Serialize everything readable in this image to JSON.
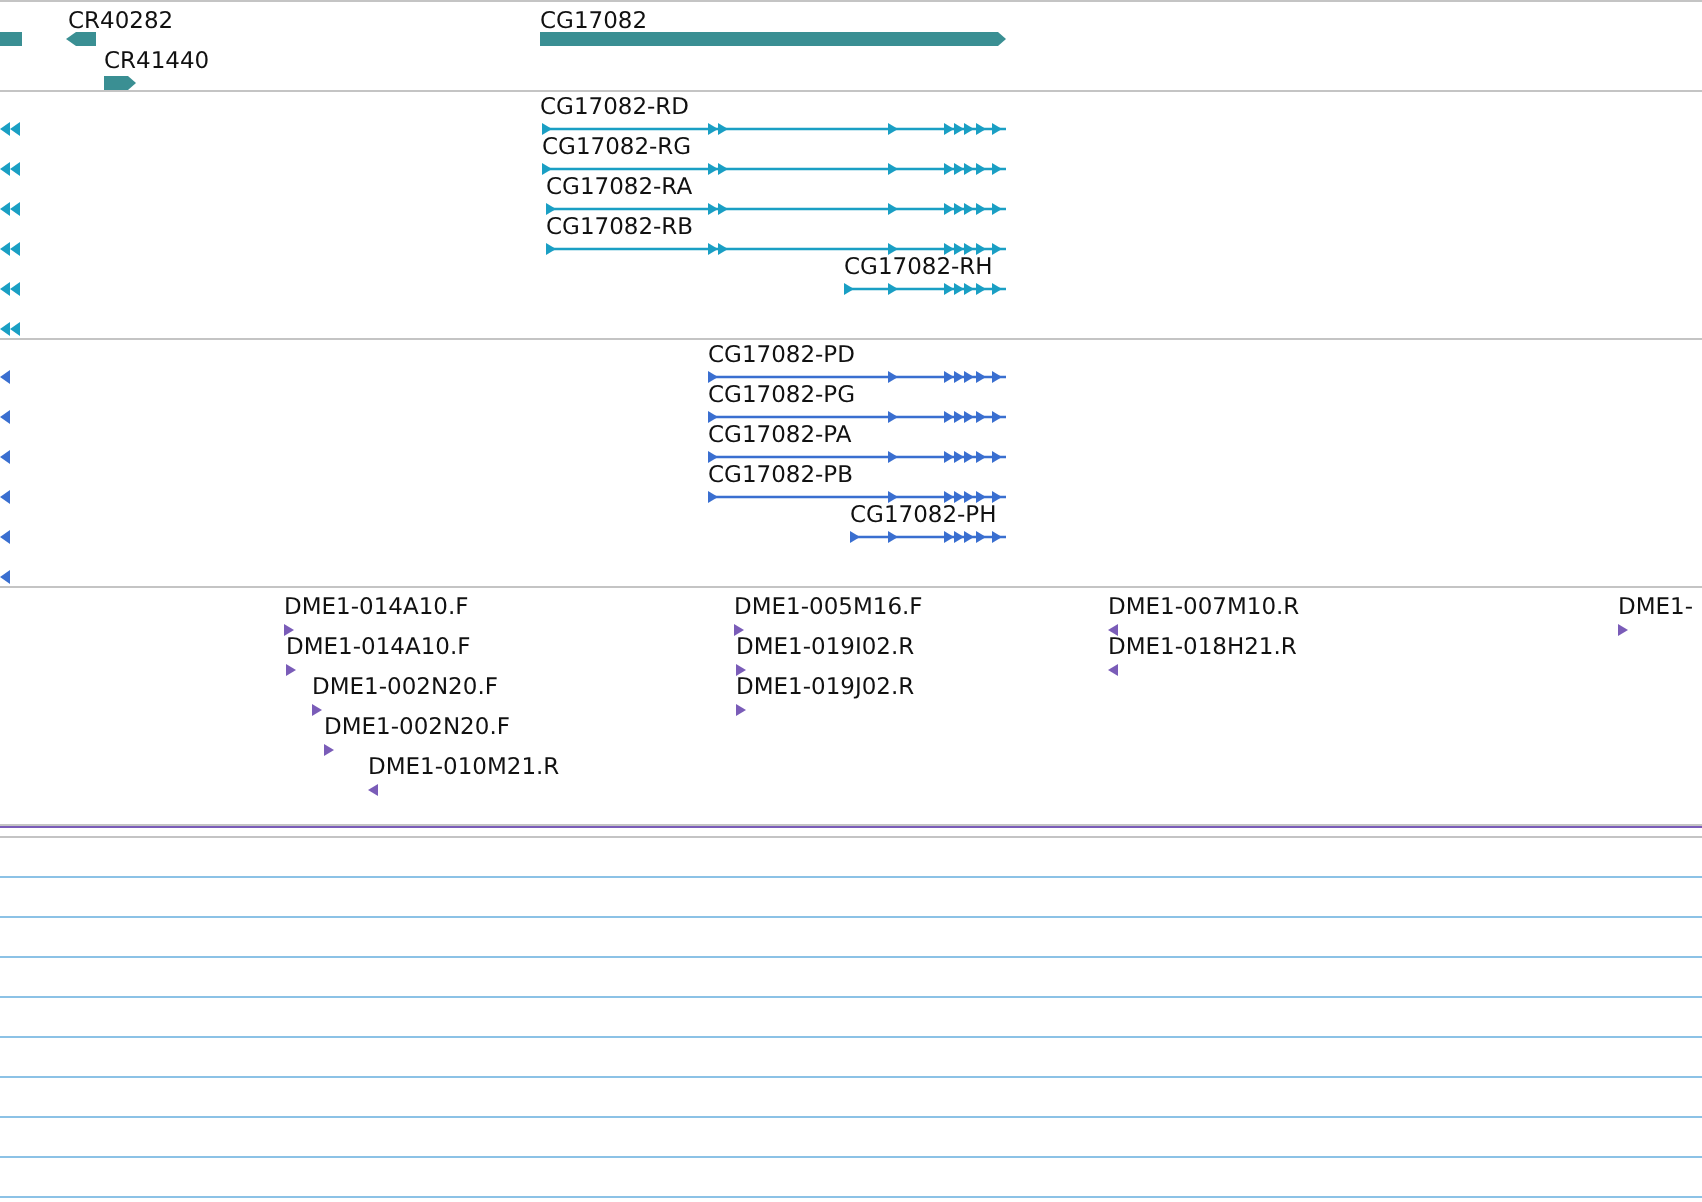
{
  "tracks": [
    {
      "kind": "genes",
      "features": [
        {
          "label": "CR40282",
          "reverse": true
        },
        {
          "label": "CG17082",
          "reverse": false
        },
        {
          "label": "CR41440",
          "reverse": false
        }
      ]
    },
    {
      "kind": "transcripts",
      "features": [
        {
          "label": "CG17082-RD"
        },
        {
          "label": "CG17082-RG"
        },
        {
          "label": "CG17082-RA"
        },
        {
          "label": "CG17082-RB"
        },
        {
          "label": "CG17082-RH"
        }
      ]
    },
    {
      "kind": "proteins",
      "features": [
        {
          "label": "CG17082-PD"
        },
        {
          "label": "CG17082-PG"
        },
        {
          "label": "CG17082-PA"
        },
        {
          "label": "CG17082-PB"
        },
        {
          "label": "CG17082-PH"
        }
      ]
    },
    {
      "kind": "clones",
      "features": [
        {
          "label": "DME1-014A10.F",
          "reverse": false
        },
        {
          "label": "DME1-014A10.F",
          "reverse": false
        },
        {
          "label": "DME1-002N20.F",
          "reverse": false
        },
        {
          "label": "DME1-002N20.F",
          "reverse": false
        },
        {
          "label": "DME1-010M21.R",
          "reverse": true
        },
        {
          "label": "DME1-005M16.F",
          "reverse": false
        },
        {
          "label": "DME1-019I02.R",
          "reverse": false
        },
        {
          "label": "DME1-019J02.R",
          "reverse": false
        },
        {
          "label": "DME1-007M10.R",
          "reverse": true
        },
        {
          "label": "DME1-018H21.R",
          "reverse": true
        },
        {
          "label": "DME1-",
          "reverse": false
        }
      ]
    }
  ]
}
